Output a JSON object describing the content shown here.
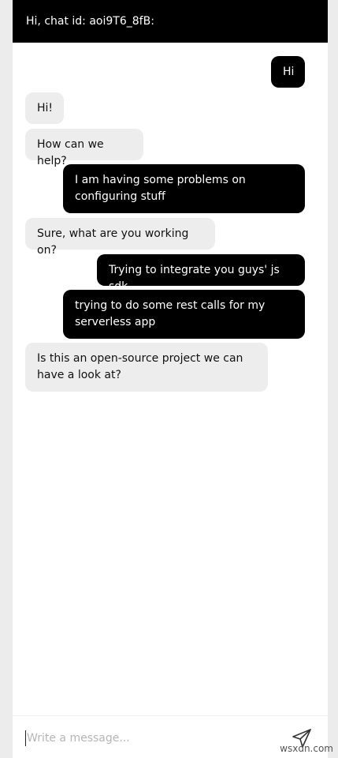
{
  "header": {
    "title": "Hi, chat id: aoi9T6_8fB:"
  },
  "messages": [
    {
      "from": "user",
      "text": "Hi"
    },
    {
      "from": "agent",
      "text": "Hi!"
    },
    {
      "from": "agent",
      "text": "How can we help?"
    },
    {
      "from": "user",
      "text": "I am having some problems on configuring stuff"
    },
    {
      "from": "agent",
      "text": "Sure, what are you working on?"
    },
    {
      "from": "user",
      "text": "Trying to integrate you guys' js sdk"
    },
    {
      "from": "user",
      "text": "trying to do some rest calls for my serverless app"
    },
    {
      "from": "agent",
      "text": "Is this an open-source project we can have a look at?"
    }
  ],
  "composer": {
    "placeholder": "Write a message...",
    "send_icon": "send-icon"
  },
  "watermark": {
    "text": "wsxdn.com"
  }
}
